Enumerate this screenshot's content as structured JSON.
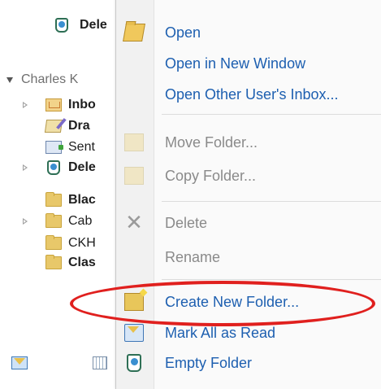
{
  "folder_pane": {
    "top_row": {
      "label": "Dele",
      "icon": "recycle-bin-icon"
    },
    "account": {
      "label": "Charles K"
    },
    "rows": [
      {
        "label": "Inbo",
        "bold": true,
        "expander": true,
        "icon": "inbox-icon"
      },
      {
        "label": "Dra",
        "bold": true,
        "expander": false,
        "icon": "drafts-icon"
      },
      {
        "label": "Sent",
        "bold": false,
        "expander": false,
        "icon": "sent-items-icon"
      },
      {
        "label": "Dele",
        "bold": true,
        "expander": true,
        "icon": "recycle-bin-icon"
      },
      {
        "label": "Blac",
        "bold": true,
        "expander": false,
        "icon": "folder-icon"
      },
      {
        "label": "Cab",
        "bold": false,
        "expander": true,
        "icon": "folder-icon"
      },
      {
        "label": "CKH",
        "bold": false,
        "expander": false,
        "icon": "folder-icon"
      },
      {
        "label": "Clas",
        "bold": true,
        "expander": false,
        "icon": "folder-icon"
      }
    ],
    "bottom_nav": [
      "mail-icon",
      "calendar-icon"
    ]
  },
  "context_menu": {
    "items": [
      {
        "label": "Open",
        "enabled": true,
        "icon": "open-folder-icon"
      },
      {
        "label": "Open in New Window",
        "enabled": true,
        "icon": ""
      },
      {
        "label": "Open Other User's Inbox...",
        "enabled": true,
        "icon": ""
      },
      {
        "label": "Move Folder...",
        "enabled": false,
        "icon": "move-folder-icon"
      },
      {
        "label": "Copy Folder...",
        "enabled": false,
        "icon": "copy-folder-icon"
      },
      {
        "label": "Delete",
        "enabled": false,
        "icon": "delete-icon"
      },
      {
        "label": "Rename",
        "enabled": false,
        "icon": ""
      },
      {
        "label": "Create New Folder...",
        "enabled": true,
        "icon": "new-folder-icon",
        "highlighted": true
      },
      {
        "label": "Mark All as Read",
        "enabled": true,
        "icon": "mark-read-icon"
      },
      {
        "label": "Empty Folder",
        "enabled": true,
        "icon": "empty-folder-icon"
      }
    ]
  },
  "colors": {
    "menu_text": "#1d5fb0",
    "disabled_text": "#8a8a8a",
    "highlight_ring": "#e0201e"
  }
}
